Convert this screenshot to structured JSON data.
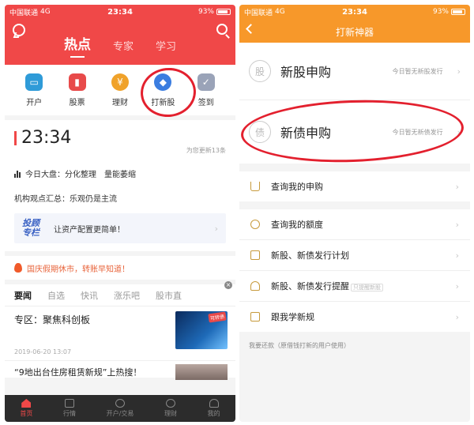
{
  "left": {
    "status": {
      "carrier": "中国联通",
      "network": "4G",
      "time": "23:34",
      "battery": "93%"
    },
    "header": {
      "tabs": [
        "热点",
        "专家",
        "学习"
      ],
      "active_tab": "热点"
    },
    "shortcuts": [
      {
        "label": "开户",
        "icon": "monitor-icon"
      },
      {
        "label": "股票",
        "icon": "candlestick-icon"
      },
      {
        "label": "理财",
        "icon": "money-bag-icon"
      },
      {
        "label": "打新股",
        "icon": "new-stock-icon"
      },
      {
        "label": "签到",
        "icon": "checkin-icon"
      }
    ],
    "news_time": "23:34",
    "updated": "为您更新13条",
    "market_line": "今日大盘：分化整理　量能萎缩",
    "opinion_line": "机构观点汇总：乐观仍是主流",
    "promo": {
      "logo_line1": "投顾",
      "logo_line2": "专栏",
      "text": "让资产配置更简单！"
    },
    "notice": "国庆假期休市，转账早知道！",
    "tabs": [
      "要闻",
      "自选",
      "快讯",
      "涨乐吧",
      "股市直"
    ],
    "close_glyph": "×",
    "news": [
      {
        "title": "专区：聚焦科创板",
        "date": "2019-06-20 13:07",
        "thumb_tag": "可转债"
      },
      {
        "title": "“9地出台住房租赁新规”上热搜！"
      }
    ],
    "tabbar": [
      "首页",
      "行情",
      "开户/交易",
      "理财",
      "我的"
    ]
  },
  "right": {
    "status": {
      "carrier": "中国联通",
      "network": "4G",
      "time": "23:34",
      "battery": "93%"
    },
    "title": "打新神器",
    "big_items": [
      {
        "badge": "股",
        "name": "新股申购",
        "hint": "今日暂无新股发行"
      },
      {
        "badge": "债",
        "name": "新债申购",
        "hint": "今日暂无新债发行"
      }
    ],
    "query": "查询我的申购",
    "items": [
      {
        "label": "查询我的额度"
      },
      {
        "label": "新股、新债发行计划"
      },
      {
        "label": "新股、新债发行提醒",
        "sub": "只提醒新股"
      },
      {
        "label": "跟我学新规"
      }
    ],
    "footnote": "我要还款（原借钱打新的用户使用）"
  },
  "colors": {
    "left_header": "#f04848",
    "right_header": "#f7982a",
    "annotation": "#e3202e"
  }
}
